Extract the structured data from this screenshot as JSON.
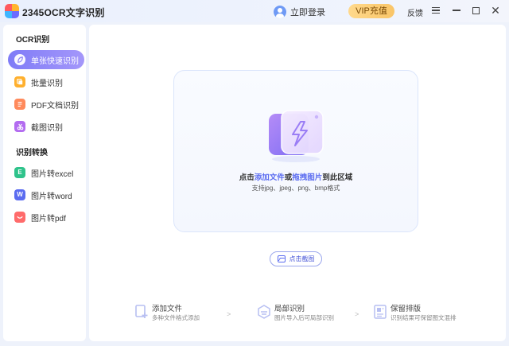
{
  "titlebar": {
    "app_title": "2345OCR文字识别",
    "login_label": "立即登录",
    "vip_label": "VIP充值",
    "feedback_label": "反馈",
    "logo_colors": [
      "#ff5a5f",
      "#ffb52e",
      "#3fb6ff",
      "#6c6cff"
    ]
  },
  "sidebar": {
    "section_ocr": "OCR识别",
    "section_convert": "识别转换",
    "items": [
      {
        "label": "单张快速识别",
        "icon": "leaf-icon",
        "color": "#8d84f5",
        "active": true
      },
      {
        "label": "批量识别",
        "icon": "stack-icon",
        "color": "#ffb02e",
        "active": false
      },
      {
        "label": "PDF文档识别",
        "icon": "document-icon",
        "color": "#ff8a5c",
        "active": false
      },
      {
        "label": "截图识别",
        "icon": "scissors-icon",
        "color": "#b36cf0",
        "active": false
      },
      {
        "label": "图片转excel",
        "icon": "excel-icon",
        "color": "#2fc38b",
        "active": false
      },
      {
        "label": "图片转word",
        "icon": "word-icon",
        "color": "#5b6cf0",
        "active": false
      },
      {
        "label": "图片转pdf",
        "icon": "pdf-icon",
        "color": "#ff6b6b",
        "active": false
      }
    ]
  },
  "dropzone": {
    "hint_prefix": "点击",
    "hint_add": "添加文件",
    "hint_or": "或",
    "hint_drag": "拖拽图片",
    "hint_suffix": "到此区域",
    "supported": "支持jpg、jpeg、png、bmp格式"
  },
  "screenshot_button": {
    "label": "点击截图"
  },
  "steps": [
    {
      "title": "添加文件",
      "desc": "多种文件格式添加",
      "icon": "add-file-icon"
    },
    {
      "title": "局部识别",
      "desc": "图片导入后可局部识别",
      "icon": "partial-recognition-icon"
    },
    {
      "title": "保留排版",
      "desc": "识别结果可保留图文混排",
      "icon": "keep-layout-icon"
    }
  ],
  "step_separator": ">",
  "accent_color": "#5b6cf0"
}
